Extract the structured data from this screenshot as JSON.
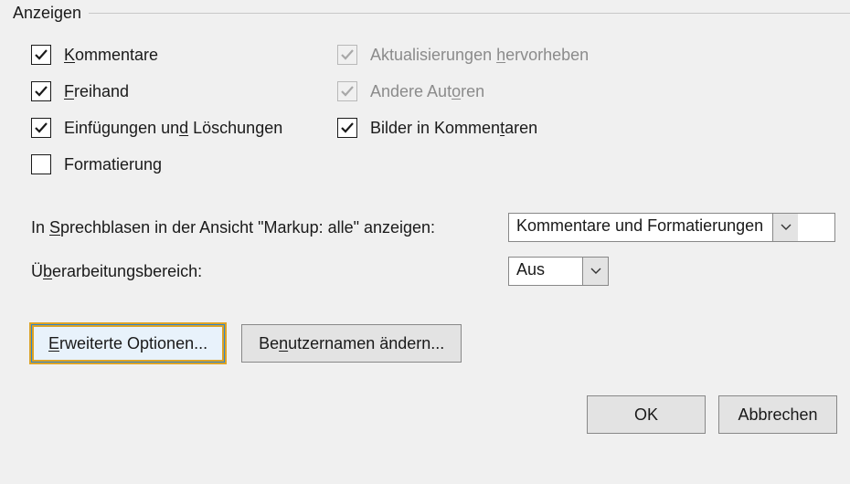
{
  "group": {
    "title": "Anzeigen"
  },
  "checks": {
    "comments": {
      "pre": "",
      "u": "K",
      "post": "ommentare",
      "checked": true,
      "disabled": false
    },
    "highlight": {
      "pre": "Aktualisierungen ",
      "u": "h",
      "post": "ervorheben",
      "checked": true,
      "disabled": true
    },
    "ink": {
      "pre": "",
      "u": "F",
      "post": "reihand",
      "checked": true,
      "disabled": false
    },
    "otherAuthors": {
      "pre": "Andere Aut",
      "u": "o",
      "post": "ren",
      "checked": true,
      "disabled": true
    },
    "insertions": {
      "pre": "Einfügungen un",
      "u": "d",
      "post": " Löschungen",
      "checked": true,
      "disabled": false
    },
    "pictures": {
      "pre": "Bilder in Kommen",
      "u": "t",
      "post": "aren",
      "checked": true,
      "disabled": false
    },
    "formatting": {
      "pre": "Formatierun",
      "u": "g",
      "post": "",
      "checked": false,
      "disabled": false
    }
  },
  "balloons": {
    "label_pre": "In ",
    "label_u": "S",
    "label_post": "prechblasen in der Ansicht \"Markup: alle\" anzeigen:",
    "value": "Kommentare und Formatierungen"
  },
  "reviewPane": {
    "label_pre": "Ü",
    "label_u": "b",
    "label_post": "erarbeitungsbereich:",
    "value": "Aus"
  },
  "buttons": {
    "advanced": {
      "pre": "",
      "u": "E",
      "post": "rweiterte Optionen..."
    },
    "username": {
      "pre": "Be",
      "u": "n",
      "post": "utzernamen ändern..."
    },
    "ok": "OK",
    "cancel": "Abbrechen"
  }
}
